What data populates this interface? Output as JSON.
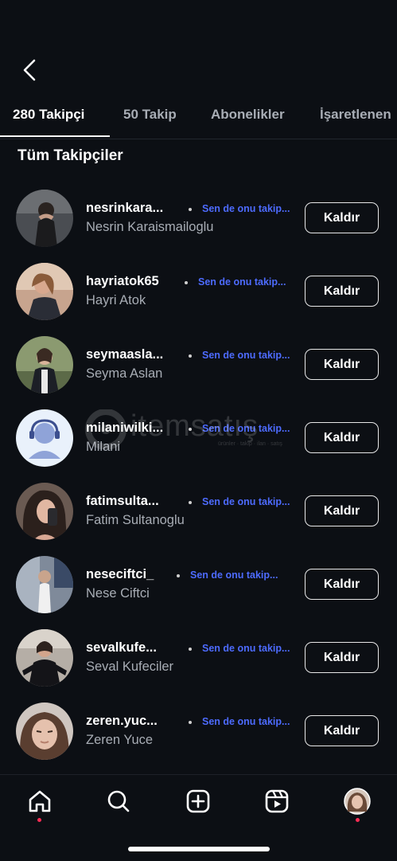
{
  "tabs": [
    {
      "label": "280 Takipçi",
      "active": true
    },
    {
      "label": "50 Takip",
      "active": false
    },
    {
      "label": "Abonelikler",
      "active": false
    },
    {
      "label": "İşaretlenen",
      "active": false
    }
  ],
  "section_title": "Tüm Takipçiler",
  "followers": [
    {
      "username": "nesrinkara...",
      "full_name": "Nesrin Karaismailoglu",
      "follow_text": "Sen de onu takip...",
      "button": "Kaldır"
    },
    {
      "username": "hayriatok65",
      "full_name": "Hayri Atok",
      "follow_text": "Sen de onu takip...",
      "button": "Kaldır"
    },
    {
      "username": "seymaasla...",
      "full_name": "Seyma Aslan",
      "follow_text": "Sen de onu takip...",
      "button": "Kaldır"
    },
    {
      "username": "milaniwilki...",
      "full_name": "Milani",
      "follow_text": "Sen de onu takip...",
      "button": "Kaldır"
    },
    {
      "username": "fatimsulta...",
      "full_name": "Fatim Sultanoglu",
      "follow_text": "Sen de onu takip...",
      "button": "Kaldır"
    },
    {
      "username": "neseciftci_",
      "full_name": "Nese Ciftci",
      "follow_text": "Sen de onu takip...",
      "button": "Kaldır"
    },
    {
      "username": "sevalkufe...",
      "full_name": "Seval Kufeciler",
      "follow_text": "Sen de onu takip...",
      "button": "Kaldır"
    },
    {
      "username": "zeren.yuc...",
      "full_name": "Zeren Yuce",
      "follow_text": "Sen de onu takip...",
      "button": "Kaldır"
    }
  ],
  "watermark": {
    "text": "itemsatış",
    "subtext": "ürünler · takip · ilan · satış"
  },
  "nav": [
    "home-icon",
    "search-icon",
    "create-icon",
    "reels-icon",
    "profile-avatar"
  ],
  "colors": {
    "background": "#0c0f14",
    "link": "#4d6bfe",
    "notification_dot": "#ff2d55"
  }
}
